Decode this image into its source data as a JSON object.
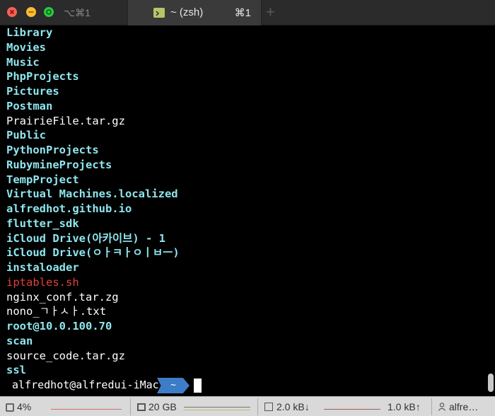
{
  "titlebar": {
    "left_shortcut": "⌥⌘1",
    "tab_title": "~ (zsh)",
    "tab_shortcut": "⌘1",
    "new_tab": "+"
  },
  "terminal": {
    "lines": [
      {
        "text": "Library",
        "kind": "dir"
      },
      {
        "text": "Movies",
        "kind": "dir"
      },
      {
        "text": "Music",
        "kind": "dir"
      },
      {
        "text": "PhpProjects",
        "kind": "dir"
      },
      {
        "text": "Pictures",
        "kind": "dir"
      },
      {
        "text": "Postman",
        "kind": "dir"
      },
      {
        "text": "PrairieFile.tar.gz",
        "kind": "file"
      },
      {
        "text": "Public",
        "kind": "dir"
      },
      {
        "text": "PythonProjects",
        "kind": "dir"
      },
      {
        "text": "RubymineProjects",
        "kind": "dir"
      },
      {
        "text": "TempProject",
        "kind": "dir"
      },
      {
        "text": "Virtual Machines.localized",
        "kind": "dir"
      },
      {
        "text": "alfredhot.github.io",
        "kind": "dir"
      },
      {
        "text": "flutter_sdk",
        "kind": "dir"
      },
      {
        "text": "iCloud Drive(아카이브) - 1",
        "kind": "dir"
      },
      {
        "text": "iCloud Drive(ㅇㅏㅋㅏㅇㅣㅂㅡ)",
        "kind": "dir"
      },
      {
        "text": "instaloader",
        "kind": "dir"
      },
      {
        "text": "iptables.sh",
        "kind": "exec"
      },
      {
        "text": "nginx_conf.tar.zg",
        "kind": "file"
      },
      {
        "text": "nono_ㄱㅏㅅㅏ.txt",
        "kind": "file"
      },
      {
        "text": "root@10.0.100.70",
        "kind": "dir"
      },
      {
        "text": "scan",
        "kind": "dir"
      },
      {
        "text": "source_code.tar.gz",
        "kind": "file"
      },
      {
        "text": "ssl",
        "kind": "dir"
      }
    ],
    "prompt_user": "alfredhot@alfredui-iMac",
    "prompt_dir": "~"
  },
  "statusbar": {
    "cpu": "4%",
    "memory": "20 GB",
    "network_down": "2.0 kB↓",
    "network_up": "1.0 kB↑",
    "user": "alfre…"
  },
  "colors": {
    "directory": "#8fe6ee",
    "file": "#ffffff",
    "executable": "#e0403a",
    "prompt_dir_bg": "#3d7dc7"
  }
}
